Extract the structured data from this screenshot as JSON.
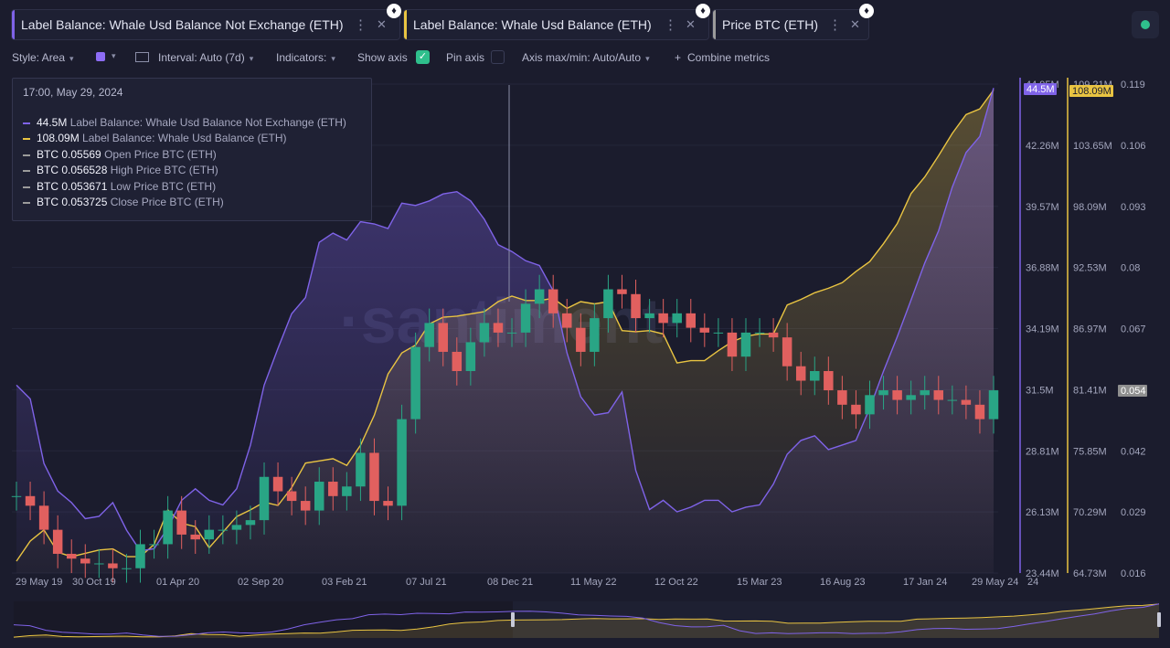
{
  "tabs": [
    {
      "label": "Label Balance: Whale Usd Balance Not Exchange (ETH)",
      "color": "#7f63e8",
      "active": true
    },
    {
      "label": "Label Balance: Whale Usd Balance (ETH)",
      "color": "#e9c442",
      "active": false
    },
    {
      "label": "Price BTC (ETH)",
      "color": "#9b9b9b",
      "active": false
    }
  ],
  "toolbar": {
    "style_label": "Style: Area",
    "interval_label": "Interval: Auto (7d)",
    "indicators_label": "Indicators:",
    "show_axis_label": "Show axis",
    "pin_axis_label": "Pin axis",
    "axis_minmax_label": "Axis max/min: Auto/Auto",
    "combine_label": "Combine metrics",
    "plus": "+",
    "show_axis_checked": true,
    "pin_axis_checked": false
  },
  "icons": {
    "close": "✕",
    "kebab": "⋮",
    "chevron": "▾",
    "check": "✓",
    "eth": "♦"
  },
  "watermark": "·santiment·",
  "legend": {
    "date": "17:00, May 29, 2024",
    "rows": [
      {
        "value": "44.5M",
        "name": "Label Balance: Whale Usd Balance Not Exchange (ETH)",
        "color": "#7f63e8"
      },
      {
        "value": "108.09M",
        "name": "Label Balance: Whale Usd Balance (ETH)",
        "color": "#e9c442"
      },
      {
        "value": "BTC 0.05569",
        "name": "Open Price BTC (ETH)",
        "color": "#9b9b9b"
      },
      {
        "value": "BTC 0.056528",
        "name": "High Price BTC (ETH)",
        "color": "#9b9b9b"
      },
      {
        "value": "BTC 0.053671",
        "name": "Low Price BTC (ETH)",
        "color": "#9b9b9b"
      },
      {
        "value": "BTC 0.053725",
        "name": "Close Price BTC (ETH)",
        "color": "#9b9b9b"
      }
    ]
  },
  "colors": {
    "bg": "#1b1c2d",
    "purple": "#7f63e8",
    "yellow": "#e9c442",
    "up": "#29a585",
    "down": "#e1605f",
    "grid": "#2a2c40"
  },
  "chart_data": {
    "type": "area",
    "x_dates": [
      "29 May 19",
      "30 Oct 19",
      "01 Apr 20",
      "02 Sep 20",
      "03 Feb 21",
      "07 Jul 21",
      "08 Dec 21",
      "11 May 22",
      "12 Oct 22",
      "15 Mar 23",
      "16 Aug 23",
      "17 Jan 24",
      "29 May 24",
      "24"
    ],
    "axes": [
      {
        "name": "Label Balance: Whale Usd Balance Not Exchange (ETH)",
        "color": "#7f63e8",
        "ticks": [
          "44.95M",
          "42.26M",
          "39.57M",
          "36.88M",
          "34.19M",
          "31.5M",
          "28.81M",
          "26.13M",
          "23.44M"
        ],
        "range": [
          23.44,
          44.95
        ],
        "current": "44.5M"
      },
      {
        "name": "Label Balance: Whale Usd Balance (ETH)",
        "color": "#e9c442",
        "ticks": [
          "109.21M",
          "103.65M",
          "98.09M",
          "92.53M",
          "86.97M",
          "81.41M",
          "75.85M",
          "70.29M",
          "64.73M"
        ],
        "range": [
          64.73,
          109.21
        ],
        "current": "108.09M"
      },
      {
        "name": "Price BTC (ETH)",
        "color": "#9b9b9b",
        "ticks": [
          "0.119",
          "0.106",
          "0.093",
          "0.08",
          "0.067",
          "",
          "0.042",
          "0.029",
          "0.016"
        ],
        "range": [
          0.016,
          0.119
        ],
        "current": "0.054"
      }
    ],
    "series": [
      {
        "name": "Label Balance: Whale Usd Balance Not Exchange (ETH)",
        "unit": "M",
        "type": "area",
        "color": "#7f63e8",
        "points": [
          [
            0,
            31.6
          ],
          [
            1,
            31.0
          ],
          [
            2,
            28.2
          ],
          [
            3,
            27.0
          ],
          [
            4,
            26.5
          ],
          [
            5,
            25.8
          ],
          [
            6,
            25.9
          ],
          [
            7,
            26.5
          ],
          [
            8,
            25.3
          ],
          [
            9,
            24.4
          ],
          [
            10,
            24.5
          ],
          [
            11,
            25.4
          ],
          [
            12,
            26.6
          ],
          [
            13,
            27.1
          ],
          [
            14,
            26.6
          ],
          [
            15,
            26.4
          ],
          [
            16,
            27.1
          ],
          [
            17,
            29.0
          ],
          [
            18,
            31.6
          ],
          [
            19,
            33.2
          ],
          [
            20,
            34.7
          ],
          [
            21,
            35.4
          ],
          [
            22,
            37.8
          ],
          [
            23,
            38.2
          ],
          [
            24,
            37.9
          ],
          [
            25,
            38.7
          ],
          [
            26,
            38.6
          ],
          [
            27,
            38.4
          ],
          [
            28,
            39.5
          ],
          [
            29,
            39.4
          ],
          [
            30,
            39.6
          ],
          [
            31,
            39.9
          ],
          [
            32,
            40.0
          ],
          [
            33,
            39.6
          ],
          [
            34,
            38.8
          ],
          [
            35,
            37.7
          ],
          [
            36,
            37.4
          ],
          [
            37,
            37.0
          ],
          [
            38,
            36.8
          ],
          [
            39,
            35.7
          ],
          [
            40,
            33.0
          ],
          [
            41,
            31.1
          ],
          [
            42,
            30.3
          ],
          [
            43,
            30.4
          ],
          [
            44,
            31.3
          ],
          [
            45,
            27.9
          ],
          [
            46,
            26.2
          ],
          [
            47,
            26.6
          ],
          [
            48,
            26.1
          ],
          [
            49,
            26.3
          ],
          [
            50,
            26.6
          ],
          [
            51,
            26.6
          ],
          [
            52,
            26.1
          ],
          [
            53,
            26.3
          ],
          [
            54,
            26.4
          ],
          [
            55,
            27.3
          ],
          [
            56,
            28.6
          ],
          [
            57,
            29.2
          ],
          [
            58,
            29.4
          ],
          [
            59,
            28.8
          ],
          [
            60,
            29.0
          ],
          [
            61,
            29.2
          ],
          [
            62,
            30.6
          ],
          [
            63,
            32.2
          ],
          [
            64,
            33.7
          ],
          [
            65,
            35.3
          ],
          [
            66,
            36.9
          ],
          [
            67,
            38.3
          ],
          [
            68,
            40.2
          ],
          [
            69,
            41.7
          ],
          [
            70,
            42.4
          ],
          [
            71,
            44.5
          ]
        ]
      },
      {
        "name": "Label Balance: Whale Usd Balance (ETH)",
        "unit": "M",
        "type": "area",
        "color": "#e9c442",
        "points": [
          [
            0,
            65.8
          ],
          [
            1,
            67.6
          ],
          [
            2,
            68.6
          ],
          [
            3,
            66.6
          ],
          [
            4,
            66.2
          ],
          [
            5,
            66.5
          ],
          [
            6,
            66.8
          ],
          [
            7,
            66.9
          ],
          [
            8,
            66.2
          ],
          [
            9,
            66.2
          ],
          [
            10,
            67.3
          ],
          [
            11,
            70.4
          ],
          [
            12,
            69.2
          ],
          [
            13,
            68.9
          ],
          [
            14,
            67.0
          ],
          [
            15,
            68.4
          ],
          [
            16,
            69.8
          ],
          [
            17,
            70.4
          ],
          [
            18,
            71.1
          ],
          [
            19,
            70.8
          ],
          [
            20,
            72.4
          ],
          [
            21,
            74.6
          ],
          [
            22,
            74.8
          ],
          [
            23,
            75.0
          ],
          [
            24,
            74.4
          ],
          [
            25,
            76.2
          ],
          [
            26,
            78.9
          ],
          [
            27,
            82.6
          ],
          [
            28,
            84.5
          ],
          [
            29,
            85.2
          ],
          [
            30,
            87.1
          ],
          [
            31,
            87.7
          ],
          [
            32,
            87.8
          ],
          [
            33,
            88.0
          ],
          [
            34,
            88.2
          ],
          [
            35,
            89.1
          ],
          [
            36,
            89.6
          ],
          [
            37,
            89.2
          ],
          [
            38,
            89.2
          ],
          [
            39,
            89.4
          ],
          [
            40,
            88.5
          ],
          [
            41,
            89.1
          ],
          [
            42,
            88.9
          ],
          [
            43,
            89.1
          ],
          [
            44,
            86.5
          ],
          [
            45,
            86.4
          ],
          [
            46,
            86.5
          ],
          [
            47,
            86.2
          ],
          [
            48,
            83.6
          ],
          [
            49,
            83.8
          ],
          [
            50,
            83.8
          ],
          [
            51,
            84.7
          ],
          [
            52,
            85.5
          ],
          [
            53,
            86.0
          ],
          [
            54,
            86.2
          ],
          [
            55,
            86.2
          ],
          [
            56,
            88.8
          ],
          [
            57,
            89.3
          ],
          [
            58,
            89.9
          ],
          [
            59,
            90.3
          ],
          [
            60,
            90.8
          ],
          [
            61,
            91.8
          ],
          [
            62,
            92.7
          ],
          [
            63,
            94.3
          ],
          [
            64,
            96.1
          ],
          [
            65,
            98.8
          ],
          [
            66,
            100.3
          ],
          [
            67,
            102.2
          ],
          [
            68,
            104.2
          ],
          [
            69,
            105.9
          ],
          [
            70,
            106.4
          ],
          [
            71,
            108.1
          ]
        ]
      },
      {
        "name": "Price BTC (ETH)",
        "type": "candlestick",
        "color": "#9b9b9b",
        "close": [
          0.032,
          0.03,
          0.025,
          0.02,
          0.019,
          0.018,
          0.018,
          0.017,
          0.017,
          0.022,
          0.022,
          0.029,
          0.024,
          0.023,
          0.025,
          0.025,
          0.026,
          0.027,
          0.036,
          0.033,
          0.031,
          0.029,
          0.035,
          0.032,
          0.034,
          0.041,
          0.031,
          0.03,
          0.048,
          0.063,
          0.068,
          0.062,
          0.058,
          0.064,
          0.068,
          0.066,
          0.066,
          0.072,
          0.075,
          0.07,
          0.067,
          0.062,
          0.069,
          0.075,
          0.074,
          0.069,
          0.07,
          0.068,
          0.07,
          0.067,
          0.066,
          0.066,
          0.061,
          0.066,
          0.066,
          0.065,
          0.059,
          0.056,
          0.058,
          0.054,
          0.051,
          0.049,
          0.053,
          0.054,
          0.052,
          0.053,
          0.054,
          0.052,
          0.052,
          0.051,
          0.048,
          0.054
        ]
      }
    ]
  }
}
